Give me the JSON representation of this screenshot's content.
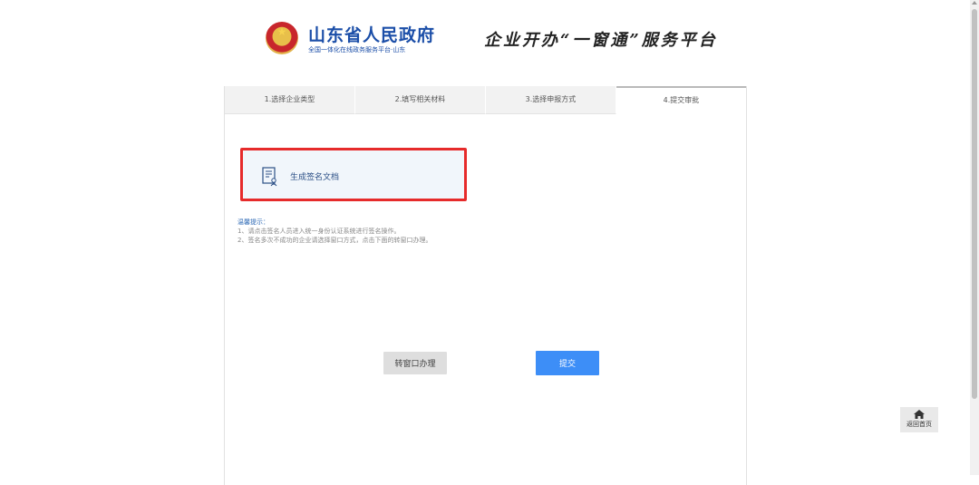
{
  "header": {
    "gov_title": "山东省人民政府",
    "gov_subtitle": "全国一体化在线政务服务平台·山东",
    "platform_title": "企业开办“一窗通”服务平台",
    "emblem_icon": "national-emblem-icon"
  },
  "steps": [
    {
      "label": "1.选择企业类型",
      "active": false
    },
    {
      "label": "2.填写相关材料",
      "active": false
    },
    {
      "label": "3.选择申报方式",
      "active": false
    },
    {
      "label": "4.提交审批",
      "active": true
    }
  ],
  "sign": {
    "label": "生成签名文档",
    "icon": "document-sign-icon",
    "highlight_color": "#e62b2b"
  },
  "tips": {
    "title": "温馨提示：",
    "lines": [
      "1、请点击签名人员进入统一身份认证系统进行签名操作。",
      "2、签名多次不成功的企业请选择窗口方式，点击下面的转窗口办理。"
    ]
  },
  "buttons": {
    "window_label": "转窗口办理",
    "submit_label": "提交",
    "submit_color": "#3d8ef7"
  },
  "home": {
    "label": "返回首页",
    "icon": "home-icon"
  }
}
